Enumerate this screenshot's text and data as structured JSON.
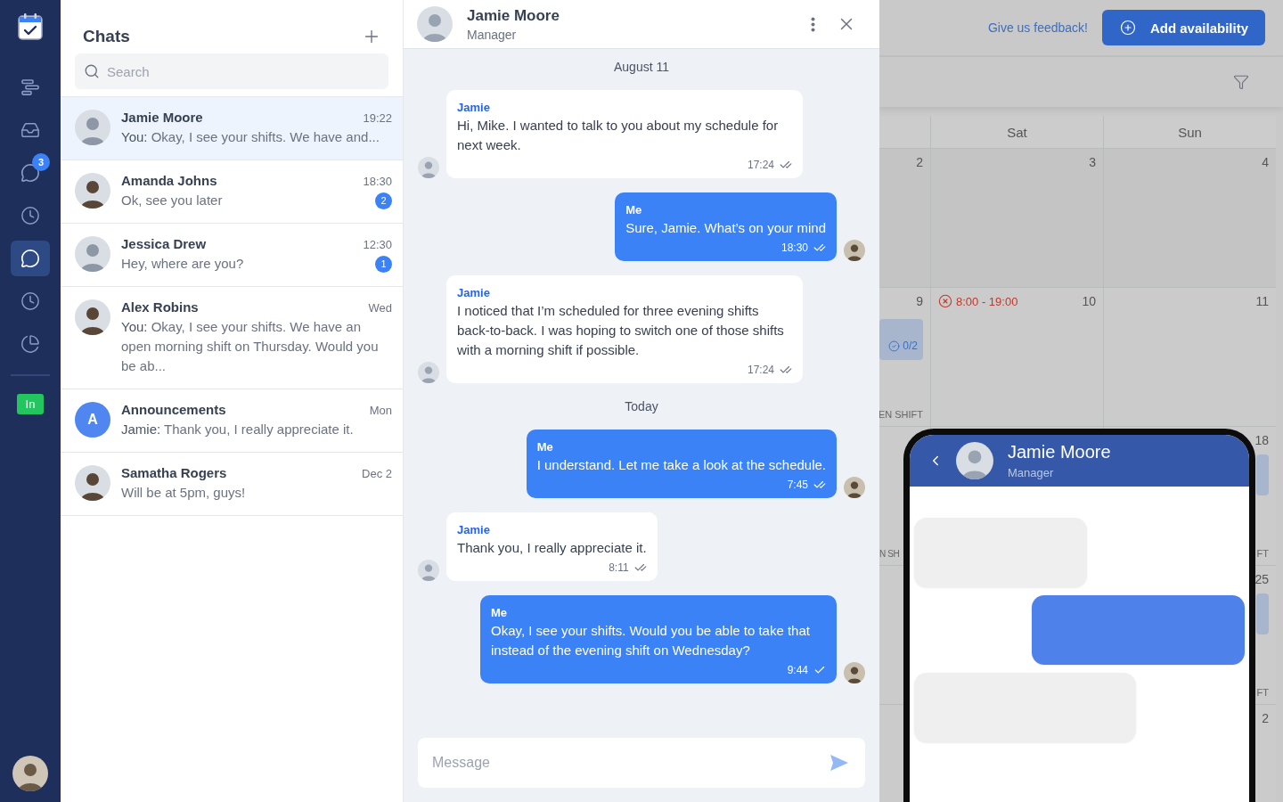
{
  "nav": {
    "items": [
      {
        "kind": "gantt",
        "selected": false
      },
      {
        "kind": "inbox",
        "selected": false
      },
      {
        "kind": "chat",
        "selected": false,
        "badge": "3"
      },
      {
        "kind": "clock",
        "selected": false
      },
      {
        "kind": "chat",
        "selected": true
      },
      {
        "kind": "clock",
        "selected": false
      },
      {
        "kind": "pie",
        "selected": false
      }
    ],
    "status": "In"
  },
  "chats": {
    "title": "Chats",
    "search": {
      "placeholder": "Search"
    },
    "items": [
      {
        "name": "Jamie Moore",
        "time": "19:22",
        "prefix": "You:",
        "preview": "Okay, I see your shifts. We have and...",
        "selected": true
      },
      {
        "name": "Amanda Johns",
        "time": "18:30",
        "preview": "Ok, see you later",
        "unread": "2",
        "selected": false
      },
      {
        "name": "Jessica Drew",
        "time": "12:30",
        "preview": "Hey, where are you?",
        "unread": "1",
        "selected": false
      },
      {
        "name": "Alex Robins",
        "time": "Wed",
        "prefix": "You:",
        "preview": "Okay, I see your shifts. We have an open morning shift on Thursday. Would you be ab...",
        "selected": false
      },
      {
        "name": "Announcements",
        "time": "Mon",
        "prefix": "Jamie:",
        "preview": "Thank you, I really appreciate it.",
        "selected": false,
        "letter": "A"
      },
      {
        "name": "Samatha Rogers",
        "time": "Dec 2",
        "preview": "Will be at 5pm, guys!",
        "selected": false
      }
    ]
  },
  "conversation": {
    "name": "Jamie Moore",
    "role": "Manager",
    "entries": [
      {
        "kind": "date",
        "text": "August 11"
      },
      {
        "kind": "incoming",
        "sender": "Jamie",
        "text": "Hi, Mike. I wanted to talk to you about my schedule for next week.",
        "time": "17:24",
        "read": true
      },
      {
        "kind": "outgoing",
        "sender": "Me",
        "text": "Sure, Jamie. What’s on your mind",
        "time": "18:30",
        "read": true
      },
      {
        "kind": "incoming",
        "sender": "Jamie",
        "text": "I noticed that I’m scheduled for three evening shifts back-to-back. I was hoping to switch one of those shifts with a morning shift if possible.",
        "time": "17:24",
        "read": true
      },
      {
        "kind": "date",
        "text": "Today"
      },
      {
        "kind": "outgoing",
        "sender": "Me",
        "text": "I understand. Let me take a look at the schedule.",
        "time": "7:45",
        "read": true
      },
      {
        "kind": "incoming",
        "sender": "Jamie",
        "text": "Thank you, I really appreciate it.",
        "time": "8:11",
        "read": true
      },
      {
        "kind": "outgoing",
        "sender": "Me",
        "text": "Okay, I see your shifts. Would you be able to take that instead of the evening shift on Wednesday?",
        "time": "9:44",
        "read": false
      }
    ],
    "composer": {
      "placeholder": "Message"
    }
  },
  "calendar": {
    "feedback_link": "Give us feedback!",
    "add_button": "Add availability",
    "columns": [
      "Sat",
      "Sun"
    ],
    "rows": [
      {
        "cells": [
          {
            "date": "2"
          },
          {
            "date": "3"
          },
          {
            "date": "4"
          }
        ]
      },
      {
        "cells": [
          {
            "date": "9",
            "shift_card": true,
            "shift_count": "0/2",
            "label": "EN SHIFT"
          },
          {
            "date": "10",
            "unavailable": "8:00 - 19:00"
          },
          {
            "date": "11"
          }
        ]
      },
      {
        "cells": [
          {
            "label": "N SH"
          },
          {},
          {
            "date": "18",
            "shift_card": true,
            "label": "FT"
          }
        ]
      },
      {
        "cells": [
          {},
          {},
          {
            "date": "25",
            "shift_card": true,
            "label": "FT"
          }
        ]
      },
      {
        "cells": [
          {},
          {},
          {
            "date": "2"
          }
        ]
      }
    ]
  },
  "phone_preview": {
    "name": "Jamie Moore",
    "role": "Manager",
    "bubbles": [
      {
        "kind": "incoming"
      },
      {
        "kind": "outgoing"
      },
      {
        "kind": "incoming"
      }
    ]
  }
}
